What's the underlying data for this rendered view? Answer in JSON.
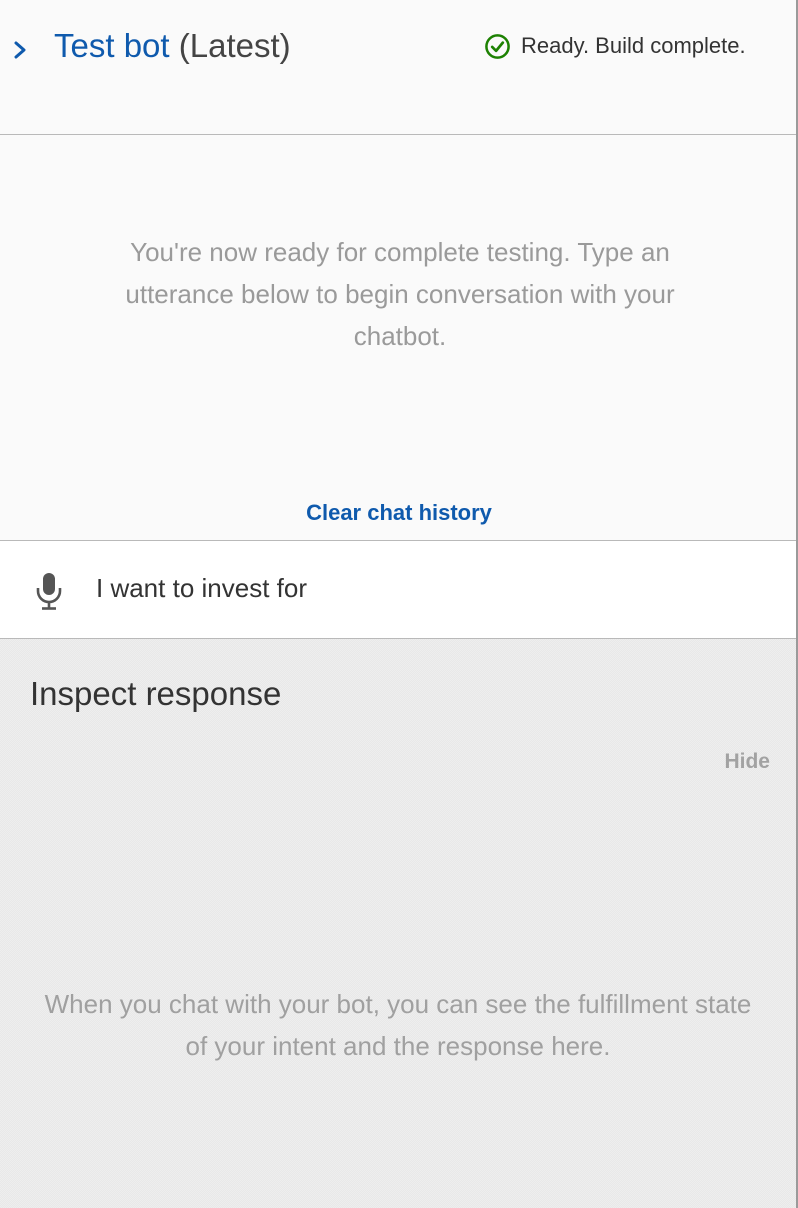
{
  "header": {
    "bot_name": "Test bot",
    "version": "(Latest)",
    "status_text": "Ready. Build complete.",
    "status_icon": "check-circle-icon",
    "expand_icon": "chevron-right-icon"
  },
  "chat": {
    "ready_message": "You're now ready for complete testing. Type an utterance below to begin conversation with your chatbot.",
    "clear_history_label": "Clear chat history"
  },
  "input": {
    "mic_icon": "microphone-icon",
    "value": "I want to invest for"
  },
  "inspect": {
    "title": "Inspect response",
    "hide_label": "Hide",
    "empty_message": "When you chat with your bot, you can see the fulfillment state of your intent and the response here."
  },
  "colors": {
    "link": "#0f5aad",
    "success": "#1d8102",
    "muted_text": "#9a9a9a"
  }
}
